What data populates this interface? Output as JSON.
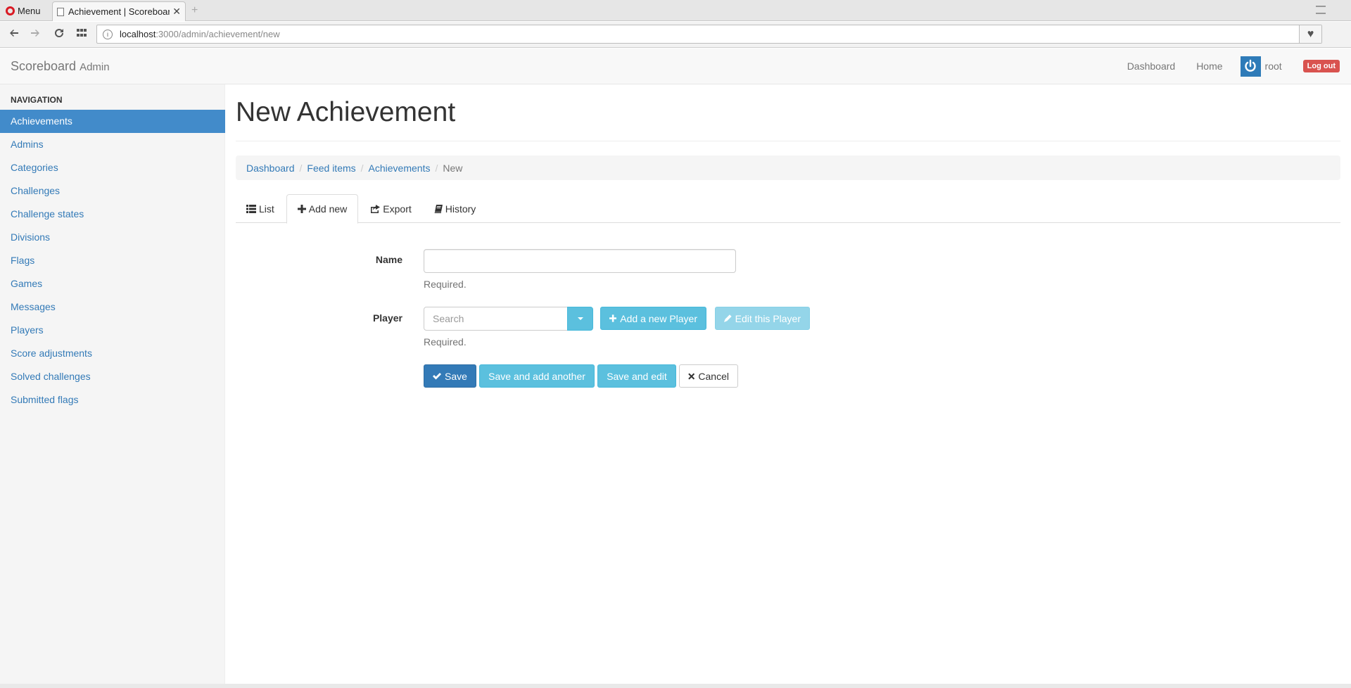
{
  "browser": {
    "menu_label": "Menu",
    "tab_title": "Achievement | Scoreboard",
    "new_tab_symbol": "+",
    "url_host": "localhost",
    "url_path": ":3000/admin/achievement/new"
  },
  "navbar": {
    "brand": "Scoreboard",
    "brand_suffix": "Admin",
    "links": [
      "Dashboard",
      "Home"
    ],
    "user": "root",
    "logout": "Log out"
  },
  "sidebar": {
    "header": "Navigation",
    "items": [
      {
        "label": "Achievements",
        "active": true
      },
      {
        "label": "Admins"
      },
      {
        "label": "Categories"
      },
      {
        "label": "Challenges"
      },
      {
        "label": "Challenge states"
      },
      {
        "label": "Divisions"
      },
      {
        "label": "Flags"
      },
      {
        "label": "Games"
      },
      {
        "label": "Messages"
      },
      {
        "label": "Players"
      },
      {
        "label": "Score adjustments"
      },
      {
        "label": "Solved challenges"
      },
      {
        "label": "Submitted flags"
      }
    ]
  },
  "main": {
    "title": "New Achievement",
    "breadcrumb": [
      "Dashboard",
      "Feed items",
      "Achievements",
      "New"
    ],
    "tabs": [
      {
        "label": "List",
        "icon": "list-icon"
      },
      {
        "label": "Add new",
        "icon": "plus-icon",
        "active": true
      },
      {
        "label": "Export",
        "icon": "share-icon"
      },
      {
        "label": "History",
        "icon": "book-icon"
      }
    ]
  },
  "form": {
    "name_label": "Name",
    "name_value": "",
    "name_help": "Required.",
    "player_label": "Player",
    "player_placeholder": "Search",
    "player_help": "Required.",
    "add_player": "Add a new Player",
    "edit_player": "Edit this Player",
    "save": "Save",
    "save_add_another": "Save and add another",
    "save_edit": "Save and edit",
    "cancel": "Cancel"
  },
  "colors": {
    "primary": "#337ab7",
    "info": "#5bc0de",
    "danger": "#d9534f",
    "sidebar_active": "#428bca"
  }
}
